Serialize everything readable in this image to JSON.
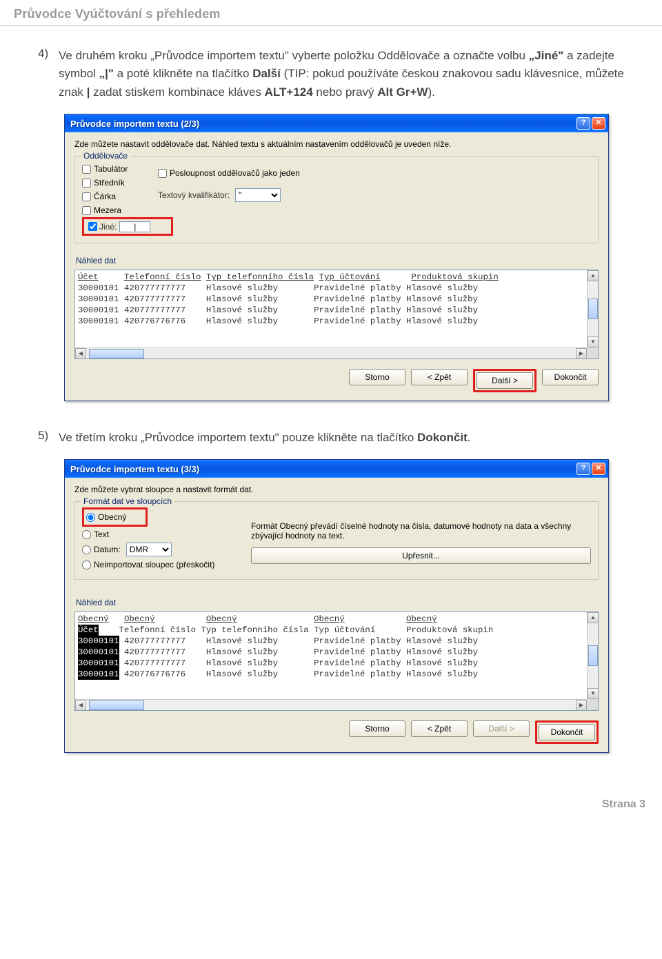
{
  "header_title": "Průvodce Vyúčtování s přehledem",
  "step4": {
    "num": "4)",
    "t1": "Ve druhém kroku „Průvodce importem textu\" vyberte položku Oddělovače a označte volbu ",
    "b1": "„Jiné\"",
    "t2": " a zadejte symbol ",
    "b2": "„|\"",
    "t3": " a poté klikněte na tlačítko ",
    "b3": "Další",
    "t4": " (TIP: pokud používáte českou znakovou sadu klávesnice, můžete znak ",
    "b4": "|",
    "t5": " zadat stiskem kombinace kláves ",
    "b5": "ALT+124",
    "t6": " nebo pravý ",
    "b6": "Alt Gr+W",
    "t7": ")."
  },
  "step5": {
    "num": "5)",
    "t1": "Ve třetím kroku „Průvodce importem textu\" pouze klikněte na tlačítko ",
    "b1": "Dokončit",
    "t2": "."
  },
  "win2": {
    "title": "Průvodce importem textu (2/3)",
    "desc": "Zde můžete nastavit oddělovače dat. Náhled textu s aktuálním nastavením oddělovačů je uveden níže.",
    "leg_delim": "Oddělovače",
    "cb_tab": "Tabulátor",
    "cb_strednik": "Středník",
    "cb_carka": "Čárka",
    "cb_mezera": "Mezera",
    "cb_jine": "Jiné:",
    "jine_val": "|",
    "cb_posloup": "Posloupnost oddělovačů jako jeden",
    "lbl_kval": "Textový kvalifikátor:",
    "kval_val": "\"",
    "leg_nahled": "Náhled dat",
    "btn_storno": "Storno",
    "btn_zpet": "< Zpět",
    "btn_dalsi": "Další >",
    "btn_dokoncit": "Dokončit"
  },
  "win3": {
    "title": "Průvodce importem textu (3/3)",
    "desc": "Zde můžete vybrat sloupce a nastavit formát dat.",
    "leg_fmt": "Formát dat ve sloupcích",
    "rb_obecny": "Obecný",
    "rb_text": "Text",
    "rb_datum": "Datum:",
    "datum_val": "DMR",
    "rb_neimport": "Neimportovat sloupec (přeskočit)",
    "fmt_note1": "Formát Obecný převádí číselné hodnoty na čísla, datumové hodnoty na data a všechny zbývající hodnoty na text.",
    "btn_upresnit": "Upřesnit...",
    "leg_nahled": "Náhled dat",
    "col_lbl": "Obecný",
    "btn_storno": "Storno",
    "btn_zpet": "< Zpět",
    "btn_dalsi": "Další >",
    "btn_dokoncit": "Dokončit"
  },
  "preview": {
    "h1": "Účet",
    "h2": "Telefonní číslo",
    "h3": "Typ telefonního čísla",
    "h4": "Typ účtování",
    "h5": "Produktová skupin",
    "rows": [
      [
        "30000101",
        "420777777777",
        "Hlasové služby",
        "Pravidelné platby",
        "Hlasové služby"
      ],
      [
        "30000101",
        "420777777777",
        "Hlasové služby",
        "Pravidelné platby",
        "Hlasové služby"
      ],
      [
        "30000101",
        "420777777777",
        "Hlasové služby",
        "Pravidelné platby",
        "Hlasové služby"
      ],
      [
        "30000101",
        "420776776776",
        "Hlasové služby",
        "Pravidelné platby",
        "Hlasové služby"
      ]
    ]
  },
  "footer": "Strana 3"
}
